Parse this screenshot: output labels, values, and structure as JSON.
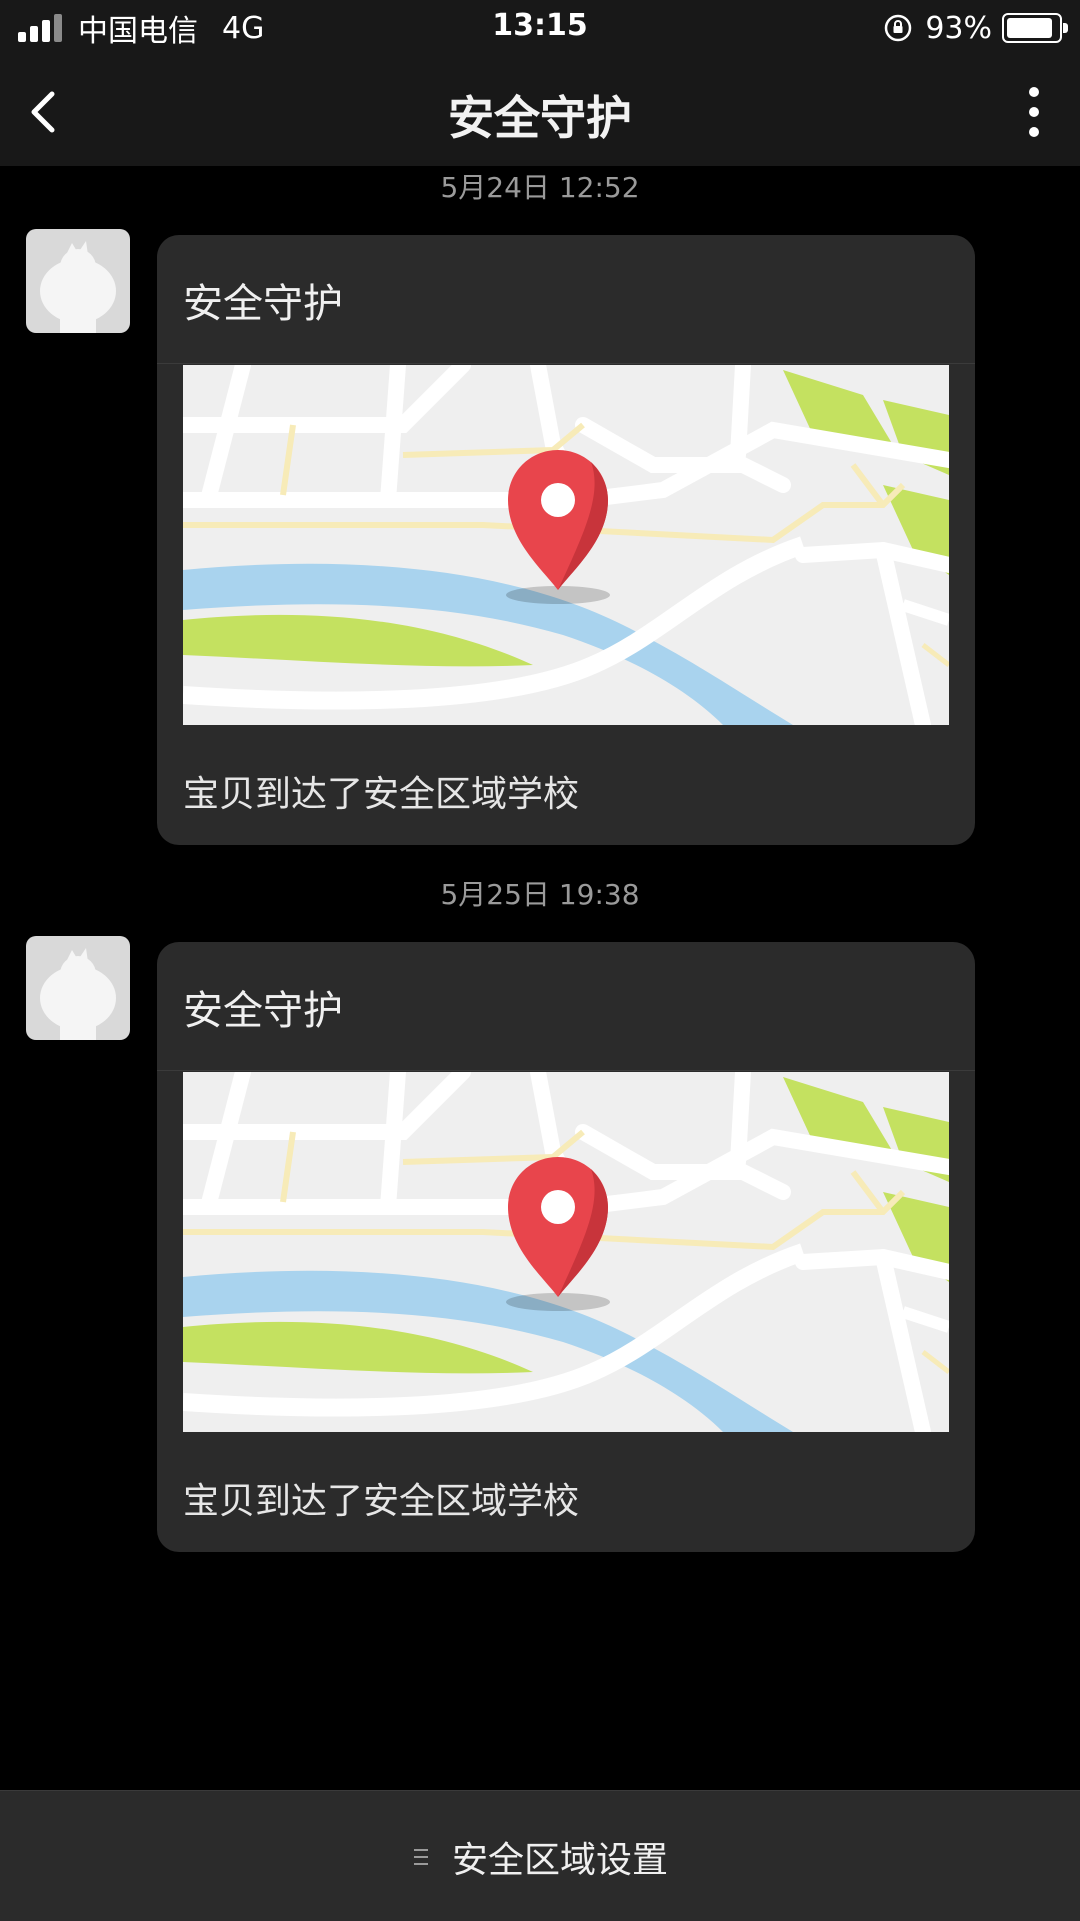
{
  "status_bar": {
    "carrier": "中国电信",
    "network": "4G",
    "time": "13:15",
    "battery_pct": "93%",
    "battery_level": 0.93
  },
  "nav": {
    "title": "安全守护",
    "back_icon": "chevron-left-icon",
    "more_icon": "more-vertical-icon"
  },
  "messages": [
    {
      "timestamp": "5月24日 12:52",
      "card_title": "安全守护",
      "text": "宝贝到达了安全区域学校"
    },
    {
      "timestamp": "5月25日 19:38",
      "card_title": "安全守护",
      "text": "宝贝到达了安全区域学校"
    }
  ],
  "bottom_bar": {
    "label": "安全区域设置",
    "icon": "menu-icon"
  },
  "colors": {
    "background": "#000000",
    "bar": "#181818",
    "card": "#2b2b2b",
    "pin": "#e8454c",
    "water": "#a9d3ee",
    "park": "#c4e160"
  }
}
